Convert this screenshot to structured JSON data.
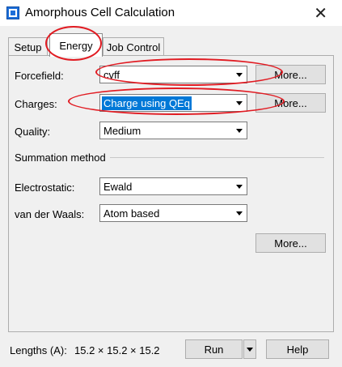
{
  "window": {
    "title": "Amorphous Cell Calculation",
    "close_glyph": "✕"
  },
  "tabs": [
    "Setup",
    "Energy",
    "Job Control"
  ],
  "energy": {
    "forcefield": {
      "label": "Forcefield:",
      "value": "cvff",
      "more": "More..."
    },
    "charges": {
      "label": "Charges:",
      "value": "Charge using QEq",
      "more": "More..."
    },
    "quality": {
      "label": "Quality:",
      "value": "Medium"
    },
    "summation": {
      "heading": "Summation method",
      "electrostatic": {
        "label": "Electrostatic:",
        "value": "Ewald"
      },
      "vdw": {
        "label": "van der Waals:",
        "value": "Atom based"
      },
      "more": "More..."
    }
  },
  "footer": {
    "lengths_label": "Lengths (A):",
    "lengths_value": "15.2 × 15.2 × 15.2",
    "run": "Run",
    "help": "Help"
  },
  "annotation_color": "#e11b22"
}
